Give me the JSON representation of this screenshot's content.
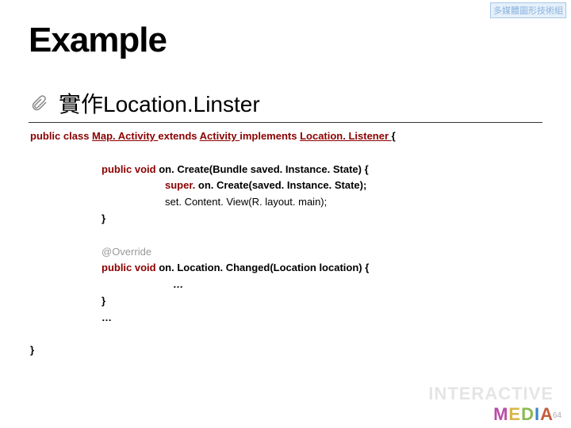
{
  "watermarkTop": "多媒體圖形技術組",
  "title": "Example",
  "subtitle": "實作Location.Linster",
  "code": {
    "l1a": "public class ",
    "l1b": "Map. Activity ",
    "l1c": "extends ",
    "l1d": "Activity ",
    "l1e": "implements ",
    "l1f": "Location. Listener ",
    "l1g": "{",
    "l2a": "public void ",
    "l2b": "on. Create(Bundle saved. Instance. State) {",
    "l3a": "super. ",
    "l3b": "on. Create(saved. Instance. State);",
    "l4": "set. Content. View(R. layout. main);",
    "l5": "}",
    "l6": "@Override",
    "l7a": "public void ",
    "l7b": "on. Location. Changed(Location location) {",
    "l8": "…",
    "l9": "}",
    "l10": "…",
    "l11": "}"
  },
  "watermarkInteractive": "INTERACTIVE",
  "watermarkMedia": "MEDIA",
  "pageNumber": "64"
}
